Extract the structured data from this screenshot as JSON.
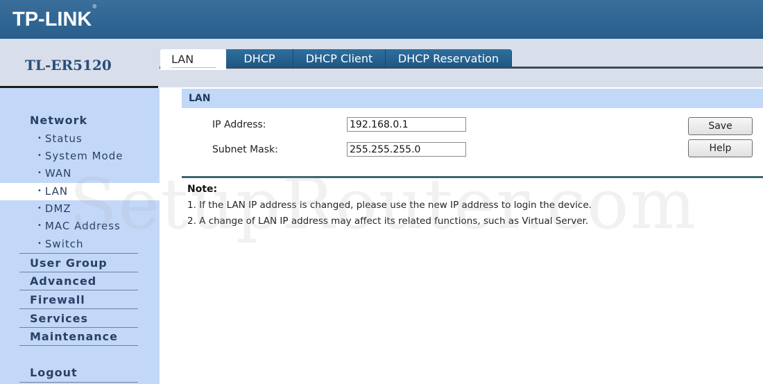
{
  "header": {
    "brand": "TP-LINK",
    "brand_mark": "®",
    "model": "TL-ER5120"
  },
  "sidebar": {
    "sections": [
      {
        "label": "Network",
        "items": [
          {
            "label": "Status",
            "active": false
          },
          {
            "label": "System Mode",
            "active": false
          },
          {
            "label": "WAN",
            "active": false
          },
          {
            "label": "LAN",
            "active": true
          },
          {
            "label": "DMZ",
            "active": false
          },
          {
            "label": "MAC Address",
            "active": false
          },
          {
            "label": "Switch",
            "active": false
          }
        ]
      },
      {
        "label": "User Group"
      },
      {
        "label": "Advanced"
      },
      {
        "label": "Firewall"
      },
      {
        "label": "Services"
      },
      {
        "label": "Maintenance"
      },
      {
        "label": "Logout"
      }
    ],
    "bullet": "•"
  },
  "tabs": [
    {
      "label": "LAN",
      "active": true
    },
    {
      "label": "DHCP",
      "active": false
    },
    {
      "label": "DHCP Client",
      "active": false
    },
    {
      "label": "DHCP Reservation",
      "active": false
    }
  ],
  "section": {
    "title": "LAN"
  },
  "form": {
    "ip_label": "IP Address:",
    "ip_value": "192.168.0.1",
    "mask_label": "Subnet Mask:",
    "mask_value": "255.255.255.0"
  },
  "buttons": {
    "save": "Save",
    "help": "Help"
  },
  "note": {
    "title": "Note:",
    "lines": [
      "1. If the LAN IP address is changed, please use the new IP address to login the device.",
      "2. A change of LAN IP address may affect its related functions, such as Virtual Server."
    ]
  },
  "watermark": "SetupRouter.com",
  "colors": {
    "header_blue": "#2f6593",
    "sidebar_bg": "#c3d8f8",
    "section_bar": "#c2d8f7",
    "nav_text": "#2a3f66"
  }
}
